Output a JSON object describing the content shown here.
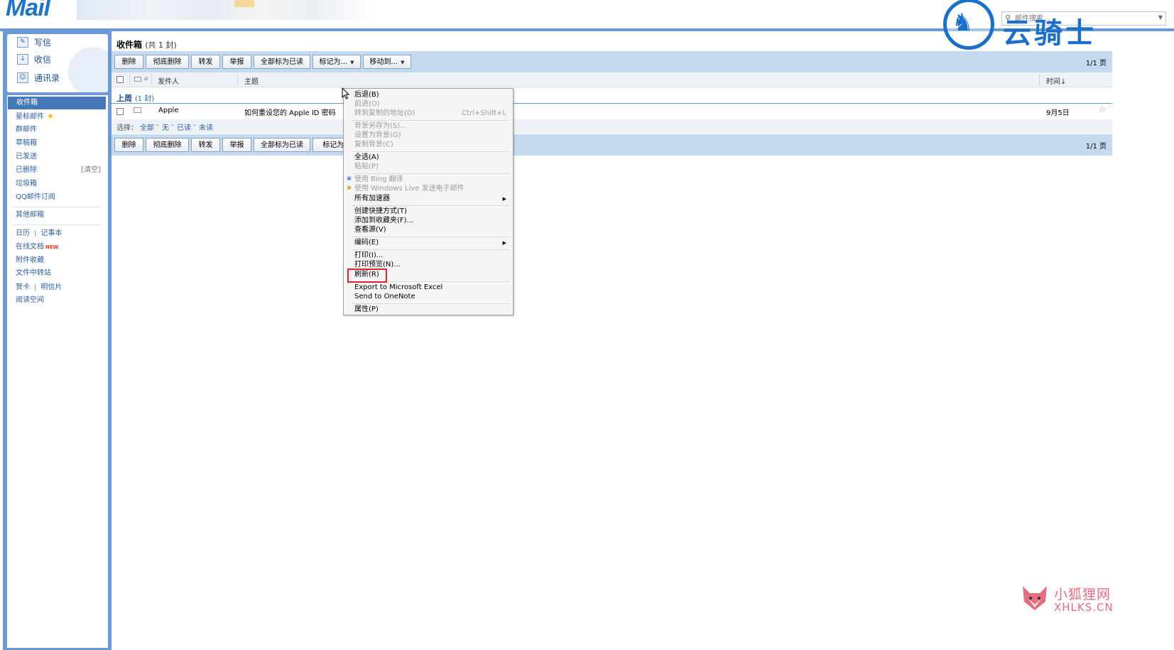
{
  "header": {
    "logo": "Mail",
    "brand_watermark": "云骑士",
    "search_placeholder": "邮件搜索..."
  },
  "sidebar": {
    "quick": [
      {
        "label": "写信",
        "icon": "pen-icon"
      },
      {
        "label": "收信",
        "icon": "inbox-download-icon"
      },
      {
        "label": "通讯录",
        "icon": "contacts-icon"
      }
    ],
    "folders": {
      "inbox": "收件箱",
      "starred": "星标邮件",
      "groups": "群邮件",
      "drafts": "草稿箱",
      "sent": "已发送",
      "deleted": "已删除",
      "deleted_clear": "[清空]",
      "spam": "垃圾箱",
      "subscriptions": "QQ邮件订阅",
      "other_mailbox": "其他邮箱",
      "calendar": "日历",
      "notebook": "记事本",
      "docs": "在线文档",
      "docs_badge": "NEW",
      "attachments": "附件收藏",
      "transfer": "文件中转站",
      "cards": "贺卡",
      "postcards": "明信片",
      "reading": "阅读空间"
    }
  },
  "main": {
    "title": "收件箱",
    "count": "(共 1 封)",
    "toolbar": {
      "delete": "删除",
      "perm_delete": "彻底删除",
      "forward": "转发",
      "report": "举报",
      "mark_all_read": "全部标为已读",
      "mark_as": "标记为...",
      "move_to": "移动到...",
      "page_info": "1/1 页"
    },
    "columns": {
      "sender": "发件人",
      "subject": "主题",
      "time": "时间↓"
    },
    "group": {
      "label": "上周",
      "count": "(1 封)"
    },
    "rows": [
      {
        "sender": "Apple",
        "subject": "如何重设您的 Apple ID 密码",
        "time": "9月5日"
      }
    ],
    "select": {
      "label": "选择：",
      "all": "全部",
      "none": "无",
      "read": "已读",
      "unread": "未读",
      "sep": "-"
    },
    "toolbar2_mark_as": "标记为..."
  },
  "context_menu": {
    "back": "后退(B)",
    "forward": "前进(O)",
    "goto_copied": "转到复制的地址(D)",
    "goto_copied_shortcut": "Ctrl+Shift+L",
    "save_bg": "背景另存为(S)...",
    "set_bg": "设置为背景(G)",
    "copy_bg": "复制背景(C)",
    "select_all": "全选(A)",
    "paste": "粘贴(P)",
    "bing_translate": "使用 Bing 翻译",
    "wl_email": "使用 Windows Live 发送电子邮件",
    "accelerators": "所有加速器",
    "create_shortcut": "创建快捷方式(T)",
    "add_favorites": "添加到收藏夹(F)...",
    "view_source": "查看源(V)",
    "encoding": "编码(E)",
    "print": "打印(I)...",
    "print_preview": "打印预览(N)...",
    "refresh": "刷新(R)",
    "export_excel": "Export to Microsoft Excel",
    "send_onenote": "Send to OneNote",
    "properties": "属性(P)"
  },
  "footer_watermark": {
    "name": "小狐狸网",
    "domain": "XHLKS.CN"
  },
  "colors": {
    "accent": "#6c9bd3",
    "toolbar_bg": "#c5d9ef",
    "active_nav": "#4677b9",
    "link": "#2c5f9e",
    "highlight_box": "#e0262a"
  }
}
